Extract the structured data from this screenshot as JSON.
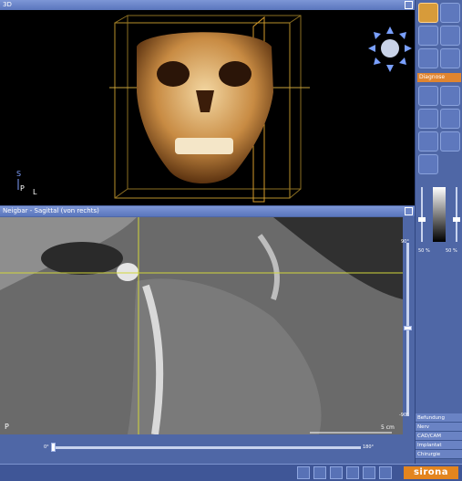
{
  "top_panel": {
    "title": "3D"
  },
  "bottom_panel": {
    "title": "Neigbar - Sagittal (von rechts)"
  },
  "orientation_3d": {
    "s": "S",
    "p": "P",
    "l": "L"
  },
  "view2d": {
    "corner_label": "P",
    "scale_label": "5 cm"
  },
  "sliders": {
    "h_min": "0°",
    "h_max": "180°",
    "v_top": "90°",
    "v_bottom": "-90°"
  },
  "right_toolbar": {
    "section_label": "Diagnose",
    "levels": {
      "left": "50 %",
      "right": "50 %"
    }
  },
  "bottom_menu": {
    "items": [
      "Befundung",
      "Nerv",
      "CAD/CAM",
      "Implantat",
      "Chirurgie"
    ]
  },
  "brand": {
    "name": "sirona"
  }
}
